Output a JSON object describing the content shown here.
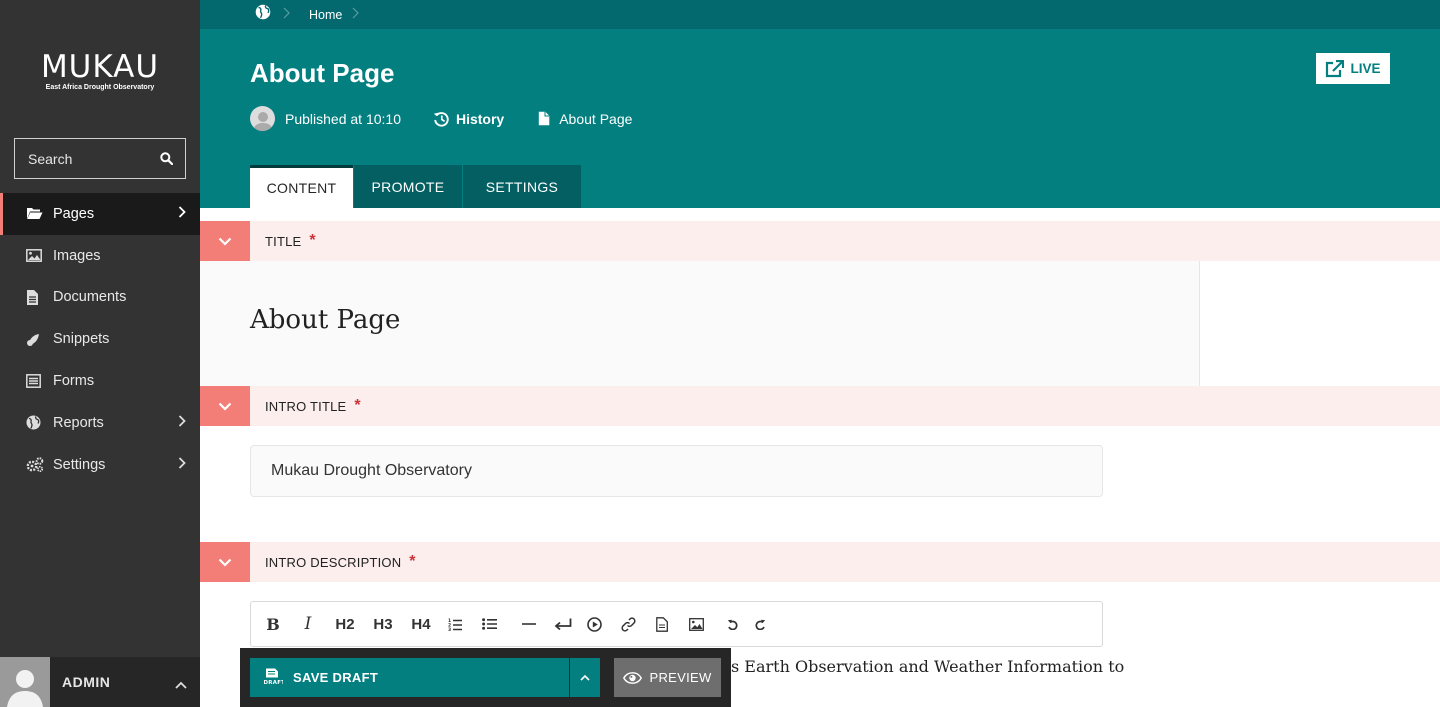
{
  "brand": {
    "title": "MUKAU",
    "subtitle": "East Africa Drought Observatory"
  },
  "search": {
    "placeholder": "Search"
  },
  "sidebar": {
    "items": [
      {
        "label": "Pages",
        "icon": "folder-open-icon",
        "has_children": true,
        "active": true
      },
      {
        "label": "Images",
        "icon": "image-icon",
        "has_children": false
      },
      {
        "label": "Documents",
        "icon": "document-icon",
        "has_children": false
      },
      {
        "label": "Snippets",
        "icon": "snippet-icon",
        "has_children": false
      },
      {
        "label": "Forms",
        "icon": "form-icon",
        "has_children": false
      },
      {
        "label": "Reports",
        "icon": "globe-icon",
        "has_children": true
      },
      {
        "label": "Settings",
        "icon": "cogs-icon",
        "has_children": true
      }
    ]
  },
  "account": {
    "name": "ADMIN"
  },
  "breadcrumb": {
    "items": [
      "Home"
    ]
  },
  "header": {
    "title": "About Page",
    "status": "Published at 10:10",
    "history_label": "History",
    "page_type": "About Page",
    "live_label": "LIVE"
  },
  "tabs": [
    {
      "label": "CONTENT",
      "active": true
    },
    {
      "label": "PROMOTE",
      "active": false
    },
    {
      "label": "SETTINGS",
      "active": false
    }
  ],
  "fields": {
    "title": {
      "label": "TITLE",
      "required": "*",
      "value": "About Page"
    },
    "intro_title": {
      "label": "INTRO TITLE",
      "required": "*",
      "value": "Mukau Drought Observatory"
    },
    "intro_description": {
      "label": "INTRO DESCRIPTION",
      "required": "*",
      "visible_text": "s Earth Observation and Weather Information to"
    }
  },
  "toolbar": {
    "buttons": [
      {
        "label": "B",
        "name": "bold-button"
      },
      {
        "label": "I",
        "name": "italic-button"
      },
      {
        "label": "H2",
        "name": "h2-button"
      },
      {
        "label": "H3",
        "name": "h3-button"
      },
      {
        "label": "H4",
        "name": "h4-button"
      }
    ]
  },
  "actions": {
    "save_label": "SAVE DRAFT",
    "draft_badge": "DRAFT",
    "preview_label": "PREVIEW"
  },
  "colors": {
    "teal": "#047f80",
    "teal_dark": "#03696e",
    "sidebar": "#333333",
    "accent": "#f37e77",
    "section_bg": "#fdeeee"
  }
}
